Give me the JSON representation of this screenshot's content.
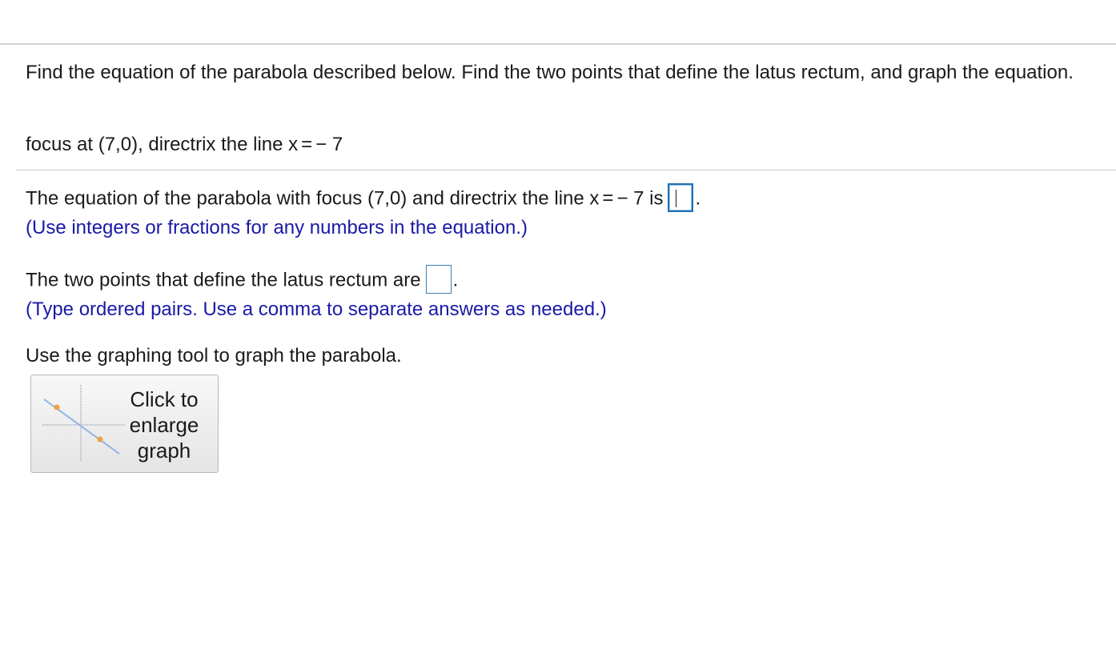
{
  "question": {
    "prompt": "Find the equation of the parabola described below. Find the two points that define the latus rectum, and graph the equation.",
    "given": {
      "prefix": "focus at (7,0), directrix the line x",
      "operator": "=",
      "value": "− 7"
    }
  },
  "part1": {
    "prefix": "The equation of the parabola with focus (7,0) and directrix the line x",
    "operator": "=",
    "value": "− 7 is",
    "suffix": ".",
    "hint": "(Use integers or fractions for any numbers in the equation.)",
    "answer": ""
  },
  "part2": {
    "prefix": "The two points that define the latus rectum are",
    "suffix": ".",
    "hint": "(Type ordered pairs. Use a comma to separate answers as needed.)",
    "answer": ""
  },
  "part3": {
    "prompt": "Use the graphing tool to graph the parabola.",
    "button": {
      "line1": "Click to",
      "line2": "enlarge",
      "line3": "graph",
      "icon": "graph-thumbnail-icon"
    }
  },
  "colors": {
    "hint_text": "#1a1aa6",
    "input_border": "#3a7fb5",
    "graph_line": "#8fb4e3",
    "graph_point": "#f0a040"
  }
}
